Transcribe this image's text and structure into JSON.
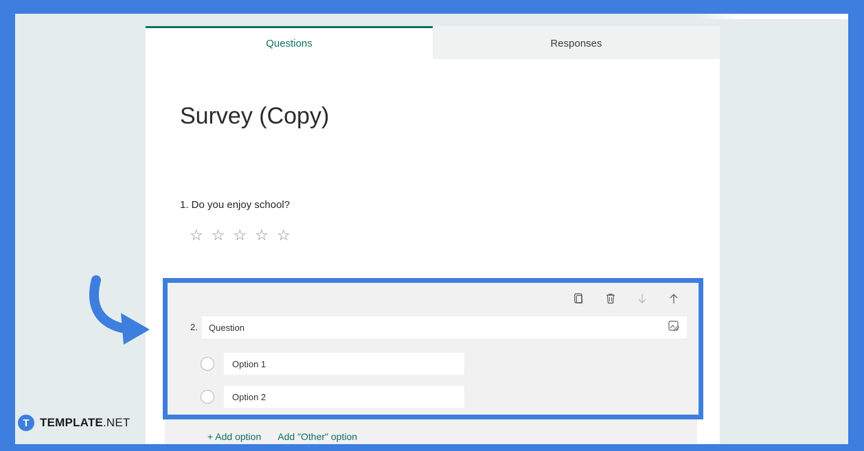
{
  "tabs": [
    {
      "label": "Questions",
      "active": true
    },
    {
      "label": "Responses",
      "active": false
    }
  ],
  "form": {
    "title": "Survey (Copy)",
    "question1": {
      "label": "1. Do you enjoy school?",
      "rating_max": 5
    },
    "question2": {
      "number": "2.",
      "value": "Question",
      "options": [
        {
          "value": "Option 1"
        },
        {
          "value": "Option 2"
        }
      ],
      "toolbar": [
        "copy-icon",
        "delete-icon",
        "move-down-icon",
        "move-up-icon"
      ],
      "add_option": "Add option",
      "add_other_option": "Add \"Other\" option"
    }
  },
  "branding": {
    "logo_letter": "T",
    "name": "TEMPLATE",
    "suffix": ".NET"
  },
  "colors": {
    "accent": "#0f6f66",
    "frame": "#3d7ede",
    "background": "#e4ecee"
  }
}
